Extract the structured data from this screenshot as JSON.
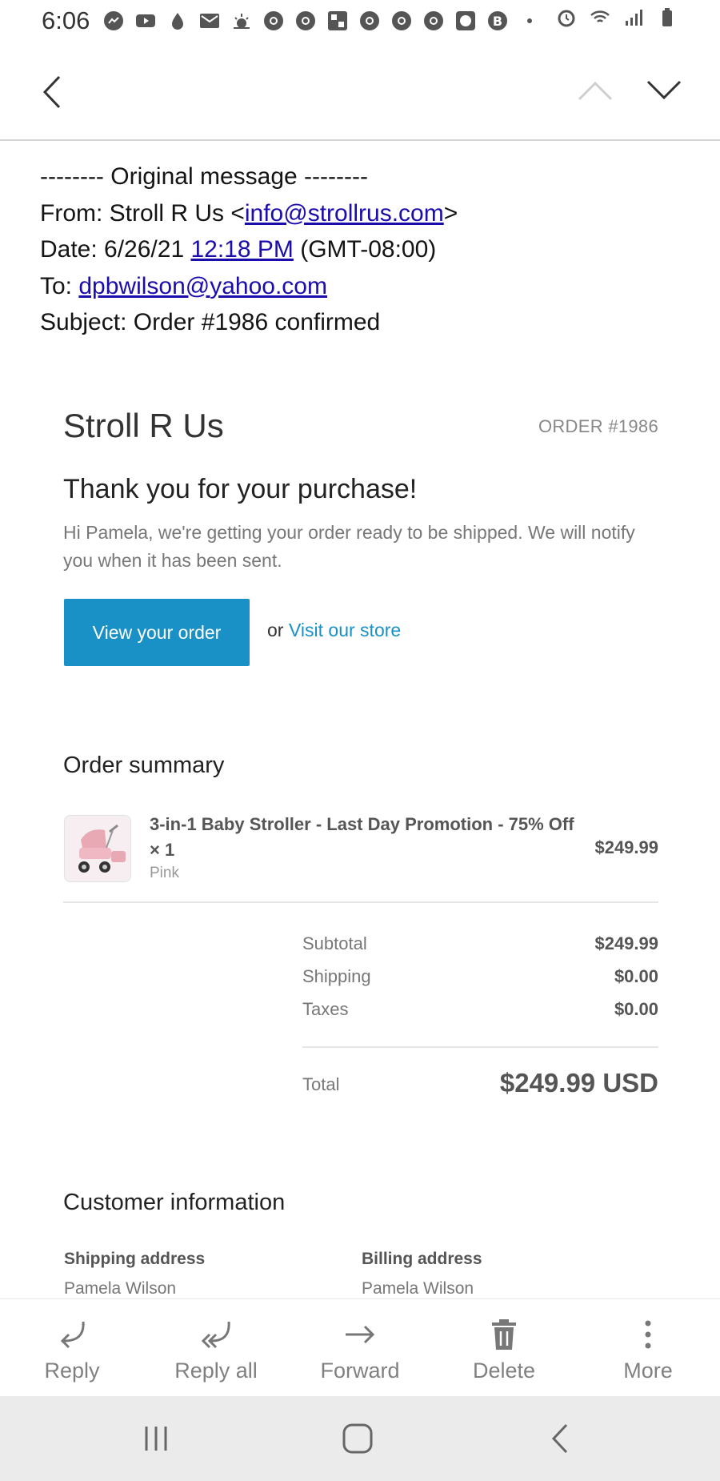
{
  "status_bar": {
    "time": "6:06"
  },
  "email_header": {
    "original_line": "-------- Original message --------",
    "from_label": "From: Stroll R Us <",
    "from_email": "info@strollrus.com",
    "from_suffix": ">",
    "date_label": "Date: 6/26/21 ",
    "date_time": "12:18 PM",
    "date_tz": " (GMT-08:00)",
    "to_label": "To: ",
    "to_email": "dpbwilson@yahoo.com",
    "subject": "Subject: Order #1986 confirmed"
  },
  "email_body": {
    "store_name": "Stroll R Us",
    "order_number": "ORDER #1986",
    "thanks": "Thank you for your purchase!",
    "intro": "Hi Pamela, we're getting your order ready to be shipped. We will notify you when it has been sent.",
    "view_order_button": "View your order",
    "or_text": "or",
    "visit_store_link": "Visit our store",
    "order_summary_title": "Order summary",
    "item": {
      "title": "3-in-1 Baby Stroller - Last Day Promotion - 75% Off × 1",
      "variant": "Pink",
      "price": "$249.99"
    },
    "summary": {
      "subtotal_label": "Subtotal",
      "subtotal_value": "$249.99",
      "shipping_label": "Shipping",
      "shipping_value": "$0.00",
      "taxes_label": "Taxes",
      "taxes_value": "$0.00",
      "total_label": "Total",
      "total_value": "$249.99 USD"
    },
    "customer_info_title": "Customer information",
    "shipping_address_title": "Shipping address",
    "shipping_name": "Pamela Wilson",
    "billing_address_title": "Billing address",
    "billing_name": "Pamela Wilson"
  },
  "actions": {
    "reply": "Reply",
    "reply_all": "Reply all",
    "forward": "Forward",
    "delete": "Delete",
    "more": "More"
  },
  "colors": {
    "link": "#1a0dab",
    "button_blue": "#1990c6",
    "nav_bar": "#ebebeb"
  }
}
